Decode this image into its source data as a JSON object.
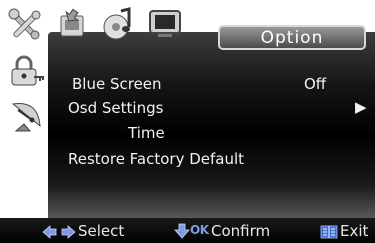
{
  "header": {
    "tabs": [
      {
        "icon": "tools-icon"
      },
      {
        "icon": "input-source-icon"
      },
      {
        "icon": "audio-icon"
      },
      {
        "icon": "display-icon"
      }
    ],
    "active_tab_label": "Option"
  },
  "sidebar": {
    "items": [
      {
        "icon": "lock-icon"
      },
      {
        "icon": "satellite-dish-icon"
      }
    ]
  },
  "menu": {
    "items": [
      {
        "label": "Blue Screen",
        "value": "Off"
      },
      {
        "label": "Osd Settings",
        "value": "▶"
      },
      {
        "label": "Time"
      },
      {
        "label": "Restore Factory Default"
      }
    ]
  },
  "footer": {
    "select_label": "Select",
    "ok_badge": "OK",
    "confirm_label": "Confirm",
    "exit_label": "Exit"
  },
  "colors": {
    "panel": "#000000",
    "tab": "#6e6e6e",
    "arrow_blue": "#6f8fd8",
    "exit_blue": "#3a6fd0",
    "text": "#f2f2f2"
  }
}
